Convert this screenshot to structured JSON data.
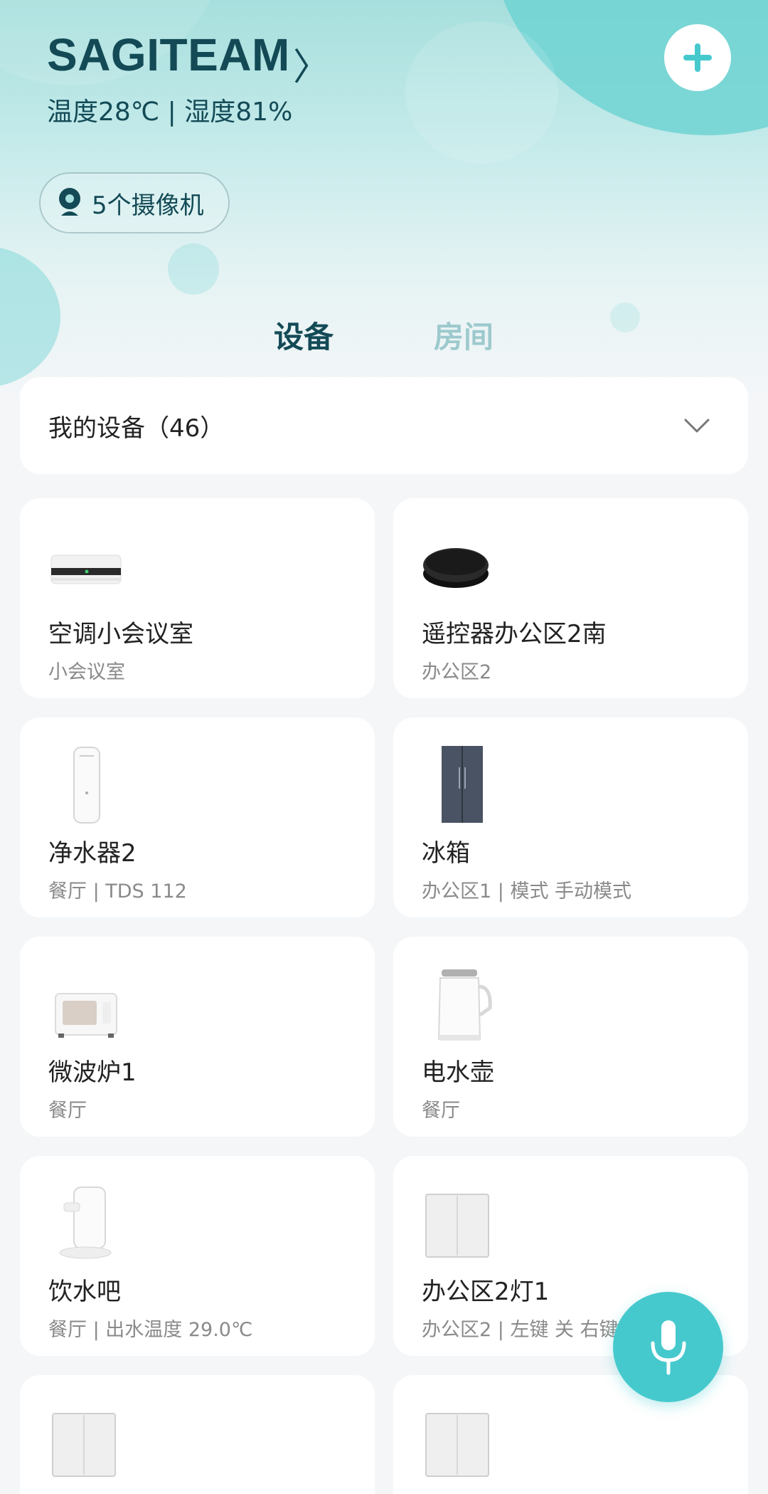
{
  "header": {
    "home_name": "SAGITEAM",
    "chevron": "〉",
    "climate": "温度28℃ | 湿度81%",
    "add_icon": "plus-icon",
    "cameras_label": "5个摄像机"
  },
  "tabs": [
    {
      "label": "设备",
      "active": true
    },
    {
      "label": "房间",
      "active": false
    }
  ],
  "device_filter": {
    "label": "我的设备（46）"
  },
  "devices": [
    {
      "name": "空调小会议室",
      "sub": "小会议室",
      "icon": "air-conditioner"
    },
    {
      "name": "遥控器办公区2南",
      "sub": "办公区2",
      "icon": "ir-remote"
    },
    {
      "name": "净水器2",
      "sub": "餐厅 | TDS 112",
      "icon": "water-purifier"
    },
    {
      "name": "冰箱",
      "sub": "办公区1 | 模式 手动模式",
      "icon": "fridge"
    },
    {
      "name": "微波炉1",
      "sub": "餐厅",
      "icon": "microwave"
    },
    {
      "name": "电水壶",
      "sub": "餐厅",
      "icon": "kettle"
    },
    {
      "name": "饮水吧",
      "sub": "餐厅 | 出水温度 29.0℃",
      "icon": "water-dispenser"
    },
    {
      "name": "办公区2灯1",
      "sub": "办公区2 | 左键 关 右键",
      "icon": "wall-switch"
    },
    {
      "name": "",
      "sub": "",
      "icon": "wall-switch"
    },
    {
      "name": "",
      "sub": "",
      "icon": "wall-switch"
    }
  ],
  "colors": {
    "accent": "#46c9cd",
    "title": "#134a56",
    "inactive_tab": "#9cc9cd"
  }
}
